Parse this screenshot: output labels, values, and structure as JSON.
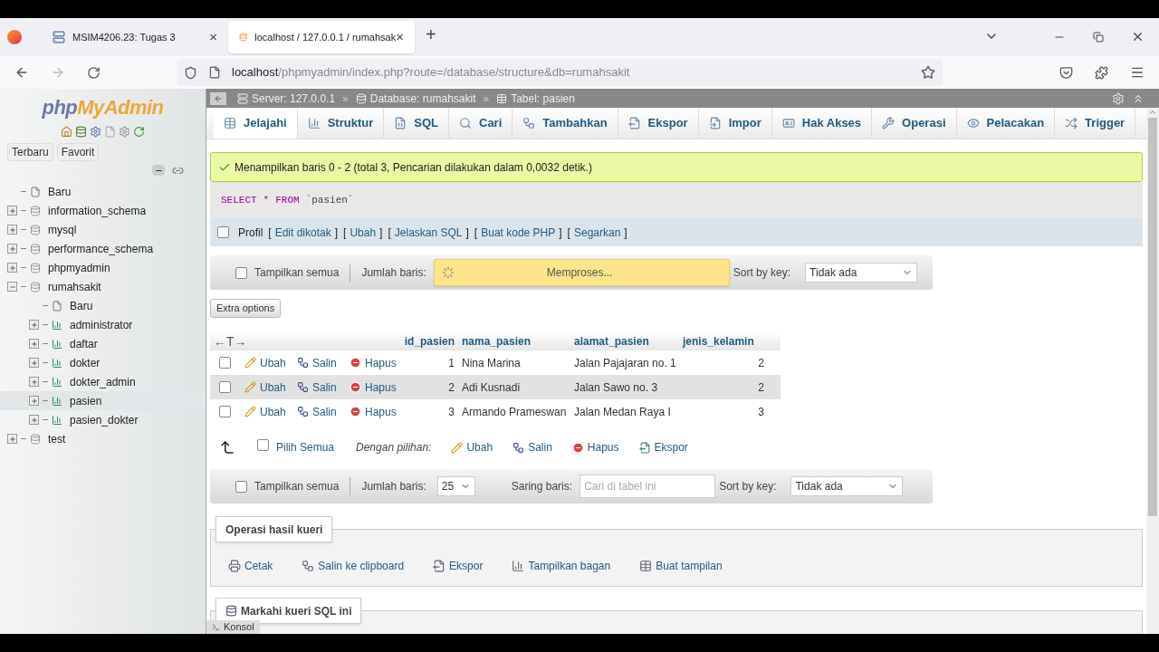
{
  "browser": {
    "tabs": [
      {
        "title": "MSIM4206.23: Tugas 3",
        "selected": false,
        "close": "×"
      },
      {
        "title": "localhost / 127.0.0.1 / rumahsak",
        "selected": true,
        "close": "×"
      }
    ],
    "new_tab": "+",
    "url": {
      "host": "localhost",
      "path": "/phpmyadmin/index.php?route=/database/structure&db=rumahsakit"
    }
  },
  "sidebar": {
    "logo": {
      "php": "php",
      "myadmin": "MyAdmin"
    },
    "buttons": [
      "Terbaru",
      "Favorit"
    ],
    "tree": [
      {
        "label": "Baru",
        "kind": "new"
      },
      {
        "label": "information_schema",
        "kind": "db",
        "expanded": false
      },
      {
        "label": "mysql",
        "kind": "db",
        "expanded": false
      },
      {
        "label": "performance_schema",
        "kind": "db",
        "expanded": false
      },
      {
        "label": "phpmyadmin",
        "kind": "db",
        "expanded": false
      },
      {
        "label": "rumahsakit",
        "kind": "db",
        "expanded": true,
        "children": [
          {
            "label": "Baru",
            "kind": "new"
          },
          {
            "label": "administrator",
            "kind": "table",
            "selected": false
          },
          {
            "label": "daftar",
            "kind": "table",
            "selected": false
          },
          {
            "label": "dokter",
            "kind": "table",
            "selected": false
          },
          {
            "label": "dokter_admin",
            "kind": "table",
            "selected": false
          },
          {
            "label": "pasien",
            "kind": "table",
            "selected": true
          },
          {
            "label": "pasien_dokter",
            "kind": "table",
            "selected": false
          }
        ]
      },
      {
        "label": "test",
        "kind": "db",
        "expanded": false
      }
    ]
  },
  "breadcrumb": {
    "separator": "»",
    "items": [
      "Server: 127.0.0.1",
      "Database: rumahsakit",
      "Tabel: pasien"
    ]
  },
  "tabs": [
    {
      "label": "Jelajahi",
      "selected": true
    },
    {
      "label": "Struktur",
      "selected": false
    },
    {
      "label": "SQL",
      "selected": false
    },
    {
      "label": "Cari",
      "selected": false
    },
    {
      "label": "Tambahkan",
      "selected": false
    },
    {
      "label": "Ekspor",
      "selected": false
    },
    {
      "label": "Impor",
      "selected": false
    },
    {
      "label": "Hak Akses",
      "selected": false
    },
    {
      "label": "Operasi",
      "selected": false
    },
    {
      "label": "Pelacakan",
      "selected": false
    },
    {
      "label": "Trigger",
      "selected": false
    }
  ],
  "message": "Menampilkan baris 0 - 2 (total 3, Pencarian dilakukan dalam 0,0032 detik.)",
  "query": [
    {
      "text": "SELECT",
      "kind": "keyword"
    },
    {
      "text": "*",
      "kind": "operator"
    },
    {
      "text": "FROM",
      "kind": "keyword"
    },
    {
      "text": "`pasien`",
      "kind": "identifier"
    }
  ],
  "profile": {
    "label": "Profil",
    "checked": false,
    "open": "[",
    "close": "]",
    "links": [
      "Edit dikotak",
      "Ubah",
      "Jelaskan SQL",
      "Buat kode PHP",
      "Segarkan"
    ]
  },
  "nav_top": {
    "show_all": {
      "label": "Tampilkan semua",
      "checked": false
    },
    "rows_label": "Jumlah baris:",
    "loading": "Memproses...",
    "sort_label": "Sort by key:",
    "sort_value": "Tidak ada"
  },
  "extra_options": "Extra options",
  "table": {
    "column_toggle": "←T→",
    "columns": [
      "id_pasien",
      "nama_pasien",
      "alamat_pasien",
      "jenis_kelamin"
    ],
    "rows": [
      {
        "checked": false,
        "hovered": false,
        "actions": [
          "Ubah",
          "Salin",
          "Hapus"
        ],
        "cells": [
          "1",
          "Nina Marina",
          "Jalan Pajajaran no. 1",
          "2"
        ]
      },
      {
        "checked": false,
        "hovered": true,
        "actions": [
          "Ubah",
          "Salin",
          "Hapus"
        ],
        "cells": [
          "2",
          "Adi Kusnadi",
          "Jalan Sawo no. 3",
          "2"
        ]
      },
      {
        "checked": false,
        "hovered": false,
        "actions": [
          "Ubah",
          "Salin",
          "Hapus"
        ],
        "cells": [
          "3",
          "Armando Prameswan",
          "Jalan Medan Raya I",
          "3"
        ]
      }
    ]
  },
  "bulk": {
    "check_all": {
      "label": "Pilih Semua",
      "checked": false
    },
    "with_selected": "Dengan pilihan:",
    "actions": [
      "Ubah",
      "Salin",
      "Hapus",
      "Ekspor"
    ]
  },
  "nav_bottom": {
    "show_all": {
      "label": "Tampilkan semua",
      "checked": false
    },
    "rows_label": "Jumlah baris:",
    "rows_value": "25",
    "filter_label": "Saring baris:",
    "filter_placeholder": "Cari di tabel ini",
    "sort_label": "Sort by key:",
    "sort_value": "Tidak ada"
  },
  "query_ops": {
    "legend": "Operasi hasil kueri",
    "actions": [
      "Cetak",
      "Salin ke clipboard",
      "Ekspor",
      "Tampilkan bagan",
      "Buat tampilan"
    ]
  },
  "bookmark_legend": "Markahi kueri SQL ini",
  "console": "Konsol"
}
